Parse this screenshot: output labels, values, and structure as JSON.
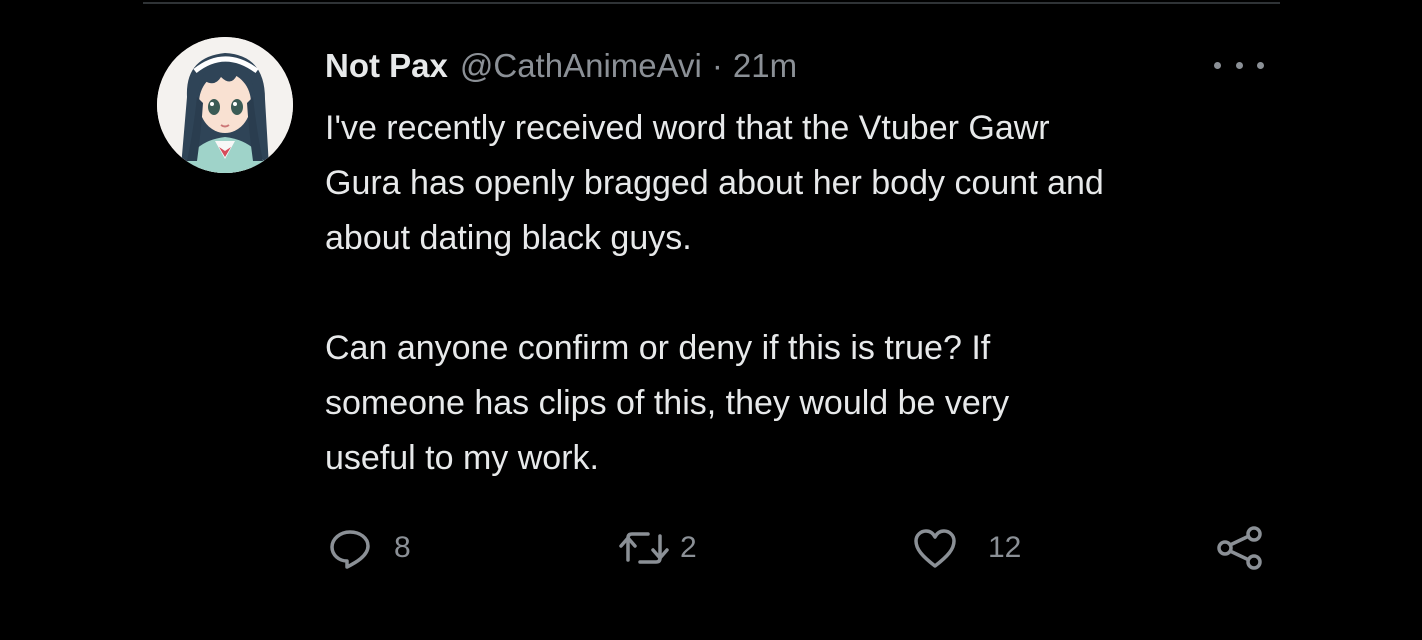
{
  "tweet": {
    "display_name": "Not Pax",
    "handle": "@CathAnimeAvi",
    "separator": "·",
    "time": "21m",
    "text_lines": [
      "I've recently received word that the Vtuber Gawr",
      "Gura has openly bragged about her body count and",
      "about dating black guys.",
      "",
      "Can anyone confirm or deny if this is true? If",
      "someone has clips of this, they would be very",
      "useful to my work."
    ]
  },
  "actions": {
    "reply_count": "8",
    "retweet_count": "2",
    "like_count": "12"
  },
  "icons": {
    "more": "more-horizontal-icon",
    "reply": "reply-icon",
    "retweet": "retweet-icon",
    "like": "heart-icon",
    "share": "share-icon"
  },
  "colors": {
    "background": "#000000",
    "text": "#e7e9ea",
    "secondary_text": "#8b9096",
    "divider": "#2f3336"
  }
}
